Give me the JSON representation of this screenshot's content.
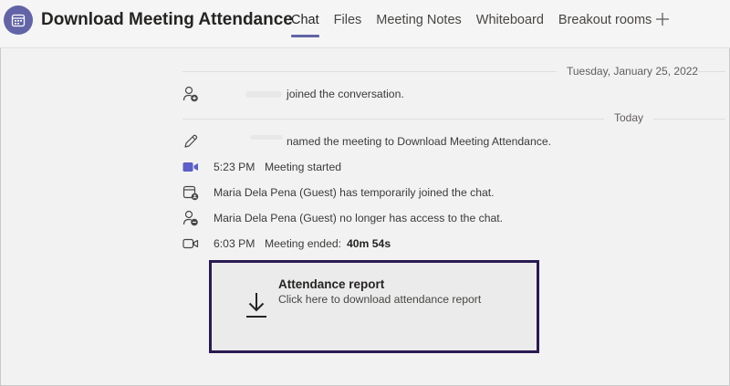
{
  "header": {
    "title": "Download Meeting Attendance",
    "tabs": [
      {
        "label": "Chat",
        "active": true
      },
      {
        "label": "Files",
        "active": false
      },
      {
        "label": "Meeting Notes",
        "active": false
      },
      {
        "label": "Whiteboard",
        "active": false
      },
      {
        "label": "Breakout rooms",
        "active": false
      }
    ],
    "add_tab_icon": "plus-icon"
  },
  "chat": {
    "date_separator_1": "Tuesday, January 25, 2022",
    "date_separator_2": "Today",
    "events": [
      {
        "icon": "person-add-icon",
        "text": "joined the conversation."
      },
      {
        "icon": "pencil-icon",
        "text": "named the meeting to Download Meeting Attendance."
      },
      {
        "icon": "video-camera-filled-icon",
        "time": "5:23 PM",
        "text": "Meeting started"
      },
      {
        "icon": "calendar-person-icon",
        "text": "Maria Dela Pena (Guest) has temporarily joined the chat."
      },
      {
        "icon": "person-remove-icon",
        "text": "Maria Dela Pena (Guest) no longer has access to the chat."
      },
      {
        "icon": "video-camera-outline-icon",
        "time": "6:03 PM",
        "text": "Meeting ended:",
        "duration": "40m 54s"
      }
    ]
  },
  "attendance_card": {
    "title": "Attendance report",
    "subtitle": "Click here to download attendance report",
    "icon": "download-icon"
  },
  "colors": {
    "accent": "#6264a7",
    "card_border": "#2a1a52",
    "background": "#f3f2f2"
  }
}
